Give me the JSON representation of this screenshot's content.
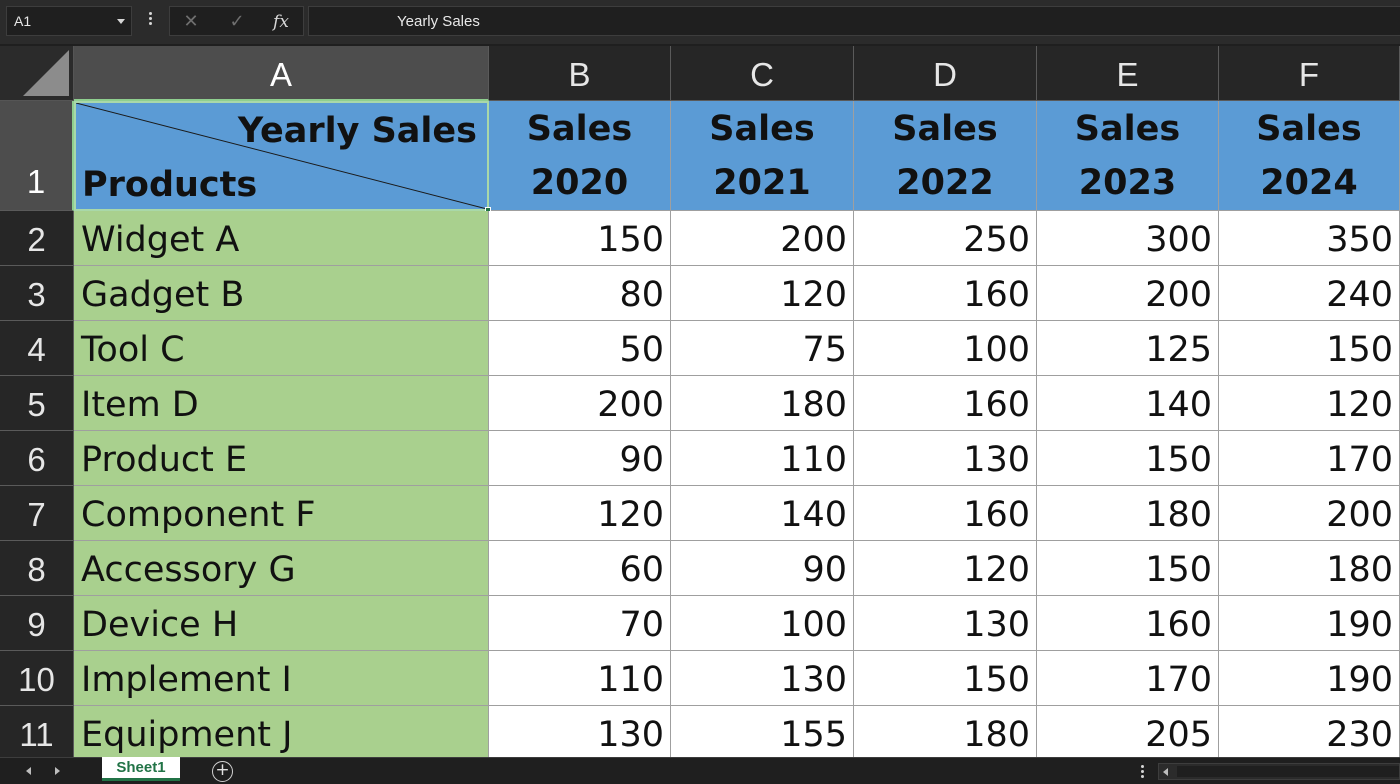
{
  "formula_bar": {
    "name_box": "A1",
    "cancel_icon": "✕",
    "enter_icon": "✓",
    "function_label": "fx",
    "formula": "Yearly Sales"
  },
  "columns": [
    "A",
    "B",
    "C",
    "D",
    "E",
    "F"
  ],
  "rows": [
    "1",
    "2",
    "3",
    "4",
    "5",
    "6",
    "7",
    "8",
    "9",
    "10",
    "11"
  ],
  "header_cell": {
    "top_right": "Yearly Sales",
    "bottom_left": "Products"
  },
  "year_headers": [
    {
      "line1": "Sales",
      "line2": "2020"
    },
    {
      "line1": "Sales",
      "line2": "2021"
    },
    {
      "line1": "Sales",
      "line2": "2022"
    },
    {
      "line1": "Sales",
      "line2": "2023"
    },
    {
      "line1": "Sales",
      "line2": "2024"
    }
  ],
  "table": [
    {
      "product": "Widget A",
      "values": [
        "150",
        "200",
        "250",
        "300",
        "350"
      ]
    },
    {
      "product": "Gadget B",
      "values": [
        "80",
        "120",
        "160",
        "200",
        "240"
      ]
    },
    {
      "product": "Tool C",
      "values": [
        "50",
        "75",
        "100",
        "125",
        "150"
      ]
    },
    {
      "product": "Item D",
      "values": [
        "200",
        "180",
        "160",
        "140",
        "120"
      ]
    },
    {
      "product": "Product E",
      "values": [
        "90",
        "110",
        "130",
        "150",
        "170"
      ]
    },
    {
      "product": "Component F",
      "values": [
        "120",
        "140",
        "160",
        "180",
        "200"
      ]
    },
    {
      "product": "Accessory G",
      "values": [
        "60",
        "90",
        "120",
        "150",
        "180"
      ]
    },
    {
      "product": "Device H",
      "values": [
        "70",
        "100",
        "130",
        "160",
        "190"
      ]
    },
    {
      "product": "Implement I",
      "values": [
        "110",
        "130",
        "150",
        "170",
        "190"
      ]
    },
    {
      "product": "Equipment J",
      "values": [
        "130",
        "155",
        "180",
        "205",
        "230"
      ]
    }
  ],
  "sheet_tabs": {
    "active": "Sheet1",
    "add_icon": "+"
  },
  "colors": {
    "header_blue": "#5b9bd5",
    "product_green": "#a9d08e",
    "excel_green": "#217346"
  }
}
